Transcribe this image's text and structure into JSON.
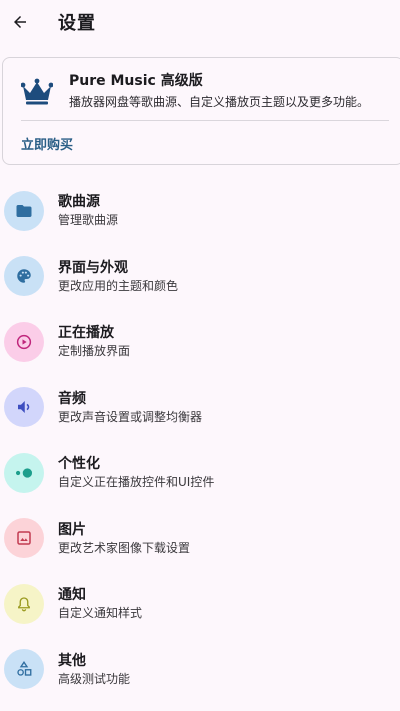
{
  "header": {
    "title": "设置",
    "back_icon": "arrow-back-icon"
  },
  "pro_card": {
    "icon": "crown-icon",
    "title": "Pure Music 高级版",
    "description": "播放器网盘等歌曲源、自定义播放页主题以及更多功能。",
    "action_label": "立即购买",
    "accent": "#1d4c7d"
  },
  "settings": {
    "items": [
      {
        "title": "歌曲源",
        "subtitle": "管理歌曲源",
        "icon": "folder-icon",
        "bg": "#c9e1f6",
        "fg": "#2f6ea0"
      },
      {
        "title": "界面与外观",
        "subtitle": "更改应用的主题和颜色",
        "icon": "palette-icon",
        "bg": "#c9e1f6",
        "fg": "#2f6ea0"
      },
      {
        "title": "正在播放",
        "subtitle": "定制播放界面",
        "icon": "play-circle-icon",
        "bg": "#fbcde8",
        "fg": "#c0267c"
      },
      {
        "title": "音频",
        "subtitle": "更改声音设置或调整均衡器",
        "icon": "volume-icon",
        "bg": "#d2d6fb",
        "fg": "#3d4ec0"
      },
      {
        "title": "个性化",
        "subtitle": "自定义正在播放控件和UI控件",
        "icon": "toggle-icon",
        "bg": "#c5f4ee",
        "fg": "#1d9e8c"
      },
      {
        "title": "图片",
        "subtitle": "更改艺术家图像下载设置",
        "icon": "image-icon",
        "bg": "#fcd3d8",
        "fg": "#c23a50"
      },
      {
        "title": "通知",
        "subtitle": "自定义通知样式",
        "icon": "bell-icon",
        "bg": "#f6f4c7",
        "fg": "#9a9a20"
      },
      {
        "title": "其他",
        "subtitle": "高级测试功能",
        "icon": "shapes-icon",
        "bg": "#c9e1f6",
        "fg": "#2f6ea0"
      }
    ]
  }
}
